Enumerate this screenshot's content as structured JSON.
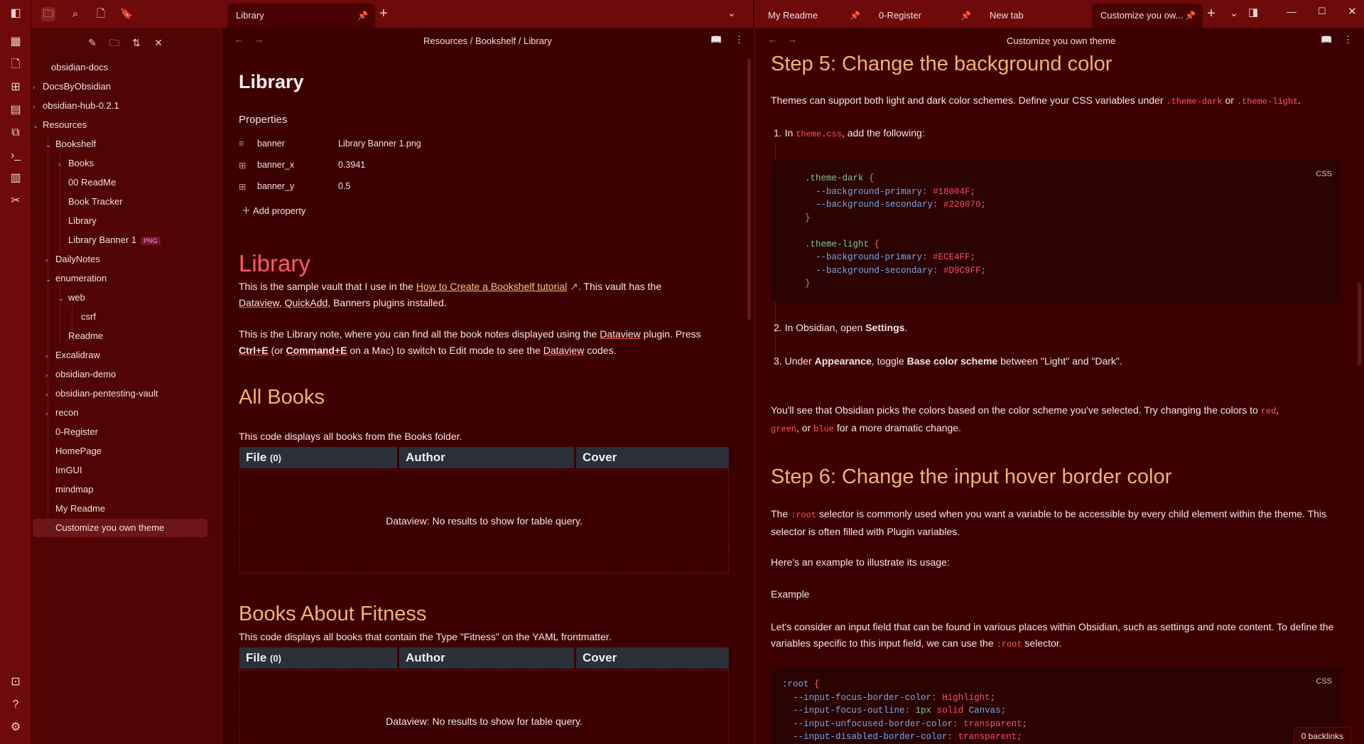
{
  "sidebar": {
    "tree": [
      {
        "label": "obsidian-docs",
        "chev": ""
      },
      {
        "label": "DocsByObsidian",
        "chev": "›"
      },
      {
        "label": "obsidian-hub-0.2.1",
        "chev": "›"
      },
      {
        "label": "Resources",
        "chev": "⌄"
      },
      {
        "label": "Bookshelf",
        "chev": "⌄"
      },
      {
        "label": "Books",
        "chev": "›"
      },
      {
        "label": "00 ReadMe",
        "chev": ""
      },
      {
        "label": "Book Tracker",
        "chev": ""
      },
      {
        "label": "Library",
        "chev": ""
      },
      {
        "label": "Library Banner 1",
        "chev": "",
        "tag": "PNG"
      },
      {
        "label": "DailyNotes",
        "chev": "›"
      },
      {
        "label": "enumeration",
        "chev": "⌄"
      },
      {
        "label": "web",
        "chev": "⌄"
      },
      {
        "label": "csrf",
        "chev": ""
      },
      {
        "label": "Readme",
        "chev": ""
      },
      {
        "label": "Excalidraw",
        "chev": "›"
      },
      {
        "label": "obsidian-demo",
        "chev": "›"
      },
      {
        "label": "obsidian-pentesting-vault",
        "chev": "›"
      },
      {
        "label": "recon",
        "chev": "›"
      },
      {
        "label": "0-Register",
        "chev": ""
      },
      {
        "label": "HomePage",
        "chev": ""
      },
      {
        "label": "ImGUI",
        "chev": ""
      },
      {
        "label": "mindmap",
        "chev": ""
      },
      {
        "label": "My Readme",
        "chev": ""
      },
      {
        "label": "Customize you own theme",
        "chev": ""
      }
    ]
  },
  "left_pane": {
    "tab": "Library",
    "breadcrumb": [
      "Resources",
      "/",
      "Bookshelf",
      "/",
      "Library"
    ],
    "title": "Library",
    "properties_heading": "Properties",
    "properties": [
      {
        "icon": "≡",
        "key": "banner",
        "value": "Library Banner 1.png"
      },
      {
        "icon": "⊞",
        "key": "banner_x",
        "value": "0.3941"
      },
      {
        "icon": "⊞",
        "key": "banner_y",
        "value": "0.5"
      }
    ],
    "add_property": "Add property",
    "h1": "Library",
    "p1_a": "This is the sample vault that I use in the ",
    "p1_link": "How to Create a Bookshelf tutorial",
    "p1_b": ". This vault has the",
    "p1_c1": "Dataview",
    "p1_c2": ", ",
    "p1_c3": "QuickAdd",
    "p1_c4": ", Banners plugins installed.",
    "p2_a": "This is the Library note, where you can find all the book notes displayed using the ",
    "p2_dv": "Dataview",
    "p2_b": " plugin. Press",
    "p2_k1": "Ctrl+E",
    "p2_c": " (or ",
    "p2_k2": "Command+E",
    "p2_d": " on a Mac) to switch to Edit mode to see the ",
    "p2_dv2": "Dataview",
    "p2_e": " codes.",
    "h2_all": "All Books",
    "all_desc": "This code displays all books from the Books folder.",
    "table_cols": [
      "File",
      "Author",
      "Cover"
    ],
    "file_count": "(0)",
    "no_results": "Dataview: No results to show for table query.",
    "h2_fit": "Books About Fitness",
    "fit_desc": "This code displays all books that contain the Type \"Fitness\" on the YAML frontmatter."
  },
  "right_pane": {
    "tabs": [
      {
        "label": "My Readme"
      },
      {
        "label": "0-Register"
      },
      {
        "label": "New tab"
      },
      {
        "label": "Customize you ow..."
      }
    ],
    "title": "Customize you own theme",
    "step5": "Step 5: Change the background color",
    "s5_p_a": "Themes can support both light and dark color schemes. Define your CSS variables under ",
    "s5_c1": ".theme-dark",
    "s5_p_b": " or ",
    "s5_c2": ".theme-light",
    "s5_p_c": ".",
    "li1_a": "In ",
    "li1_c": "theme.css",
    "li1_b": ", add the following:",
    "css_label": "CSS",
    "code1": [
      [
        {
          "t": ".theme-dark",
          "c": "cb-sel"
        },
        {
          "t": " {",
          "c": "cb-br"
        }
      ],
      [
        {
          "t": "  --background-primary",
          "c": "cb-prop"
        },
        {
          "t": ": ",
          "c": "cb-br"
        },
        {
          "t": "#18004F",
          "c": "cb-val"
        },
        {
          "t": ";",
          "c": "cb-br"
        }
      ],
      [
        {
          "t": "  --background-secondary",
          "c": "cb-prop"
        },
        {
          "t": ": ",
          "c": "cb-br"
        },
        {
          "t": "#220070",
          "c": "cb-val"
        },
        {
          "t": ";",
          "c": "cb-br"
        }
      ],
      [
        {
          "t": "}",
          "c": "cb-br"
        }
      ],
      [
        {
          "t": "",
          "c": "cb-br"
        }
      ],
      [
        {
          "t": ".theme-light",
          "c": "cb-sel"
        },
        {
          "t": " {",
          "c": "cb-br"
        }
      ],
      [
        {
          "t": "  --background-primary",
          "c": "cb-prop"
        },
        {
          "t": ": ",
          "c": "cb-br"
        },
        {
          "t": "#ECE4FF",
          "c": "cb-val"
        },
        {
          "t": ";",
          "c": "cb-br"
        }
      ],
      [
        {
          "t": "  --background-secondary",
          "c": "cb-prop"
        },
        {
          "t": ": ",
          "c": "cb-br"
        },
        {
          "t": "#D9C9FF",
          "c": "cb-val"
        },
        {
          "t": ";",
          "c": "cb-br"
        }
      ],
      [
        {
          "t": "}",
          "c": "cb-br"
        }
      ]
    ],
    "li2_a": "In Obsidian, open ",
    "li2_b": "Settings",
    "li2_c": ".",
    "li3_a": "Under ",
    "li3_b": "Appearance",
    "li3_c": ", toggle ",
    "li3_d": "Base color scheme",
    "li3_e": " between \"Light\" and \"Dark\".",
    "p_see_a": "You'll see that Obsidian picks the colors based on the color scheme you've selected. Try changing the colors to ",
    "p_see_red": "red",
    "p_see_b": ",",
    "p_see_green": "green",
    "p_see_c": ", or ",
    "p_see_blue": "blue",
    "p_see_d": " for a more dramatic change.",
    "step6": "Step 6: Change the input hover border color",
    "s6_a": "The ",
    "s6_c": ":root",
    "s6_b": " selector is commonly used when you want a variable to be accessible by every child element within the theme. This selector is often filled with Plugin variables.",
    "s6_p2": "Here's an example to illustrate its usage:",
    "s6_p3": "Example",
    "s6_p4_a": "Let's consider an input field that can be found in various places within Obsidian, such as settings and note content. To define the variables specific to this input field, we can use the ",
    "s6_p4_c": ":root",
    "s6_p4_b": " selector.",
    "code2": [
      [
        {
          "t": ":root",
          "c": "cb-prop"
        },
        {
          "t": " {",
          "c": "cb-br"
        }
      ],
      [
        {
          "t": "  --input-focus-border-color",
          "c": "cb-prop"
        },
        {
          "t": ": ",
          "c": "cb-br"
        },
        {
          "t": "Highlight",
          "c": "cb-val"
        },
        {
          "t": ";",
          "c": "cb-br"
        }
      ],
      [
        {
          "t": "  --input-focus-outline",
          "c": "cb-prop"
        },
        {
          "t": ": ",
          "c": "cb-br"
        },
        {
          "t": "1px",
          "c": "cb-sel"
        },
        {
          "t": " solid ",
          "c": "cb-val"
        },
        {
          "t": "Canvas",
          "c": "cb-prop"
        },
        {
          "t": ";",
          "c": "cb-br"
        }
      ],
      [
        {
          "t": "  --input-unfocused-border-color",
          "c": "cb-prop"
        },
        {
          "t": ": ",
          "c": "cb-br"
        },
        {
          "t": "transparent",
          "c": "cb-val"
        },
        {
          "t": ";",
          "c": "cb-br"
        }
      ],
      [
        {
          "t": "  --input-disabled-border-color",
          "c": "cb-prop"
        },
        {
          "t": ": ",
          "c": "cb-br"
        },
        {
          "t": "transparent",
          "c": "cb-val"
        },
        {
          "t": ";",
          "c": "cb-br"
        }
      ]
    ]
  },
  "status": {
    "backlinks": "0 backlinks"
  }
}
